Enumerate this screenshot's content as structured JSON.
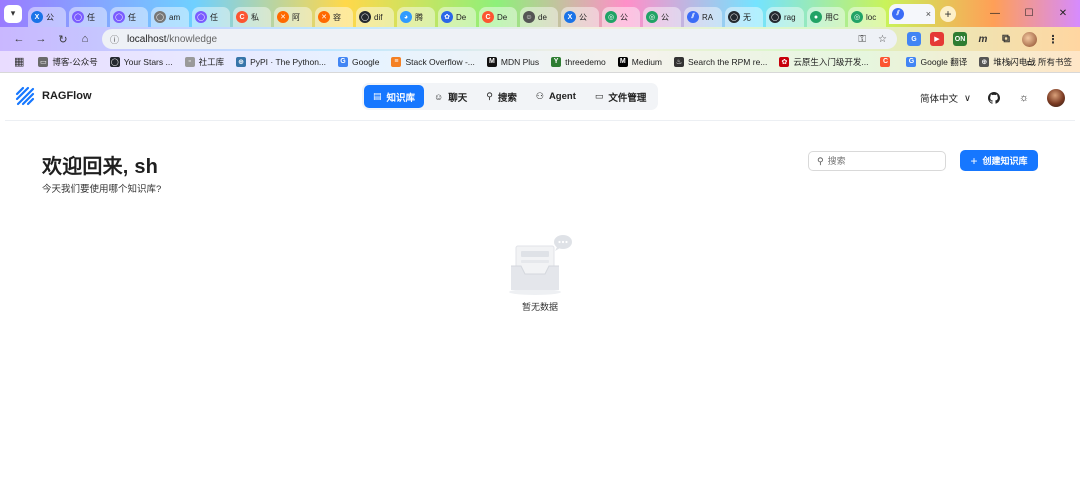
{
  "browser": {
    "tabs": [
      {
        "label": "公",
        "color": "#1a73e8",
        "glyph": "X"
      },
      {
        "label": "任",
        "color": "#7a5cff",
        "glyph": "◯"
      },
      {
        "label": "任",
        "color": "#7a5cff",
        "glyph": "◯"
      },
      {
        "label": "am",
        "color": "#777777",
        "glyph": "◯"
      },
      {
        "label": "任",
        "color": "#7a5cff",
        "glyph": "◯"
      },
      {
        "label": "私",
        "color": "#fc5531",
        "glyph": "C"
      },
      {
        "label": "阿",
        "color": "#ff6a00",
        "glyph": "✕"
      },
      {
        "label": "容",
        "color": "#ff6a00",
        "glyph": "✕"
      },
      {
        "label": "dif",
        "color": "#24292f",
        "glyph": "◯"
      },
      {
        "label": "腾",
        "color": "#2f9bff",
        "glyph": "◕"
      },
      {
        "label": "De",
        "color": "#2a66e8",
        "glyph": "✿"
      },
      {
        "label": "De",
        "color": "#fc5531",
        "glyph": "C"
      },
      {
        "label": "de",
        "color": "#555555",
        "glyph": "☺"
      },
      {
        "label": "公",
        "color": "#1a73e8",
        "glyph": "X"
      },
      {
        "label": "公",
        "color": "#21a366",
        "glyph": "◎"
      },
      {
        "label": "公",
        "color": "#21a366",
        "glyph": "◎"
      },
      {
        "label": "RA",
        "color": "#3b6cf6",
        "glyph": "⫽"
      },
      {
        "label": "无",
        "color": "#24292f",
        "glyph": "◯"
      },
      {
        "label": "rag",
        "color": "#24292f",
        "glyph": "◯"
      },
      {
        "label": "用C",
        "color": "#21a366",
        "glyph": "●"
      },
      {
        "label": "loc",
        "color": "#21a366",
        "glyph": "◎"
      }
    ],
    "active_tab": {
      "close": "×"
    },
    "new_tab": "+",
    "window_controls": {
      "minimize": "—",
      "maximize": "☐",
      "close": "✕"
    },
    "url_host": "localhost",
    "url_path": "/knowledge",
    "bookmarks": [
      {
        "label": "博客-公众号",
        "color": "#6b6b6b",
        "glyph": "▭"
      },
      {
        "label": "Your Stars ...",
        "color": "#24292f",
        "glyph": "◯"
      },
      {
        "label": "社工库",
        "color": "#9a9a9a",
        "glyph": "▫"
      },
      {
        "label": "PyPI · The Python...",
        "color": "#3775a9",
        "glyph": "⊕"
      },
      {
        "label": "Google",
        "color": "#4285f4",
        "glyph": "G"
      },
      {
        "label": "Stack Overflow -...",
        "color": "#f48024",
        "glyph": "≡"
      },
      {
        "label": "MDN Plus",
        "color": "#111111",
        "glyph": "M"
      },
      {
        "label": "threedemo",
        "color": "#2e7d32",
        "glyph": "Y"
      },
      {
        "label": "Medium",
        "color": "#000000",
        "glyph": "M"
      },
      {
        "label": "Search the RPM re...",
        "color": "#333333",
        "glyph": "♨"
      },
      {
        "label": "云原生入门级开发...",
        "color": "#c7000b",
        "glyph": "✿"
      },
      {
        "label": "",
        "color": "#fc5531",
        "glyph": "C"
      },
      {
        "label": "Google 翻译",
        "color": "#4285f4",
        "glyph": "G"
      },
      {
        "label": "堆栈闪电战",
        "color": "#555555",
        "glyph": "⊕"
      }
    ],
    "bookmarks_more": "»",
    "all_bookmarks": "所有书签"
  },
  "app": {
    "brand": "RAGFlow",
    "nav": [
      {
        "label": "知识库",
        "icon": "database-icon",
        "glyph": "▤",
        "active": true
      },
      {
        "label": "聊天",
        "icon": "chat-icon",
        "glyph": "☺",
        "active": false
      },
      {
        "label": "搜索",
        "icon": "search-icon",
        "glyph": "⚲",
        "active": false
      },
      {
        "label": "Agent",
        "icon": "agent-icon",
        "glyph": "⚇",
        "active": false
      },
      {
        "label": "文件管理",
        "icon": "folder-icon",
        "glyph": "▭",
        "active": false
      }
    ],
    "language": "简体中文",
    "language_caret": "∨"
  },
  "main": {
    "welcome_title": "欢迎回来, sh",
    "welcome_subtitle": "今天我们要使用哪个知识库?",
    "search_placeholder": "搜索",
    "create_button": "创建知识库",
    "create_plus": "+",
    "empty_text": "暂无数据"
  },
  "colors": {
    "accent": "#1677ff",
    "text": "#1f1f1f",
    "border": "#d9d9d9"
  }
}
